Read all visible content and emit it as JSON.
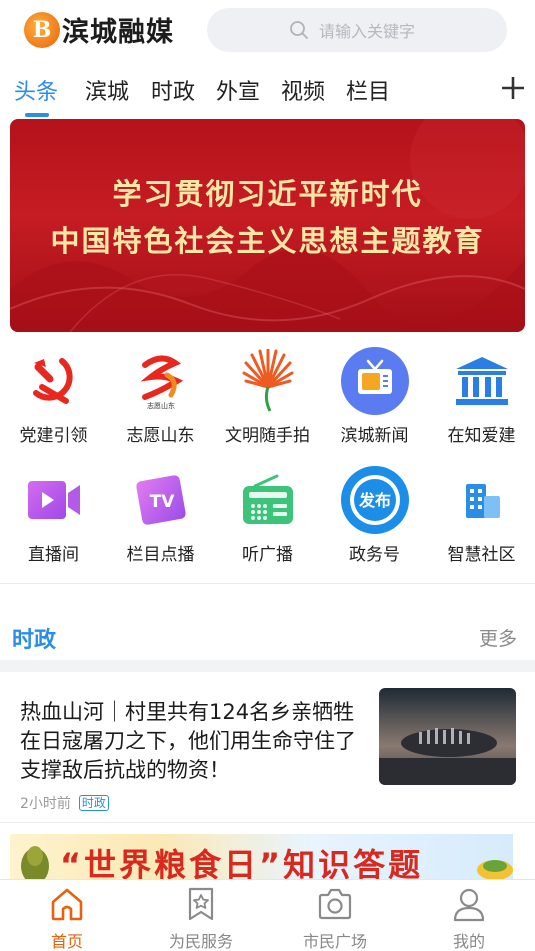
{
  "header": {
    "logo_mark": "B",
    "logo_text": "滨城融媒",
    "search_placeholder": "请输入关键字"
  },
  "tabs": [
    {
      "label": "头条",
      "active": true
    },
    {
      "label": "滨城",
      "active": false
    },
    {
      "label": "时政",
      "active": false
    },
    {
      "label": "外宣",
      "active": false
    },
    {
      "label": "视频",
      "active": false
    },
    {
      "label": "栏目",
      "active": false
    }
  ],
  "banner": {
    "line1": "学习贯彻习近平新时代",
    "line2": "中国特色社会主义思想主题教育"
  },
  "grid": [
    {
      "label": "党建引领",
      "icon": "hammer-sickle-icon"
    },
    {
      "label": "志愿山东",
      "icon": "volunteer-shandong-icon",
      "icon_text": "志愿山东"
    },
    {
      "label": "文明随手拍",
      "icon": "civilization-fan-icon"
    },
    {
      "label": "滨城新闻",
      "icon": "tv-news-icon"
    },
    {
      "label": "在知爱建",
      "icon": "building-icon"
    },
    {
      "label": "直播间",
      "icon": "video-camera-icon"
    },
    {
      "label": "栏目点播",
      "icon": "tv-play-icon",
      "icon_text": "TV"
    },
    {
      "label": "听广播",
      "icon": "radio-icon"
    },
    {
      "label": "政务号",
      "icon": "government-badge-icon",
      "icon_text": "发布"
    },
    {
      "label": "智慧社区",
      "icon": "community-building-icon"
    }
  ],
  "section": {
    "title": "时政",
    "more": "更多"
  },
  "news": {
    "title": "热血山河｜村里共有124名乡亲牺牲在日寇屠刀之下，他们用生命守住了支撑敌后抗战的物资！",
    "time": "2小时前",
    "tag": "时政"
  },
  "promo": {
    "text": "“世界粮食日”知识答题"
  },
  "bottom_nav": [
    {
      "label": "首页",
      "active": true,
      "icon": "home-icon"
    },
    {
      "label": "为民服务",
      "active": false,
      "icon": "bookmark-star-icon"
    },
    {
      "label": "市民广场",
      "active": false,
      "icon": "camera-icon"
    },
    {
      "label": "我的",
      "active": false,
      "icon": "user-icon"
    }
  ],
  "colors": {
    "accent": "#2a8ee6",
    "brand_orange": "#e8610c",
    "banner_red": "#c61c23"
  }
}
